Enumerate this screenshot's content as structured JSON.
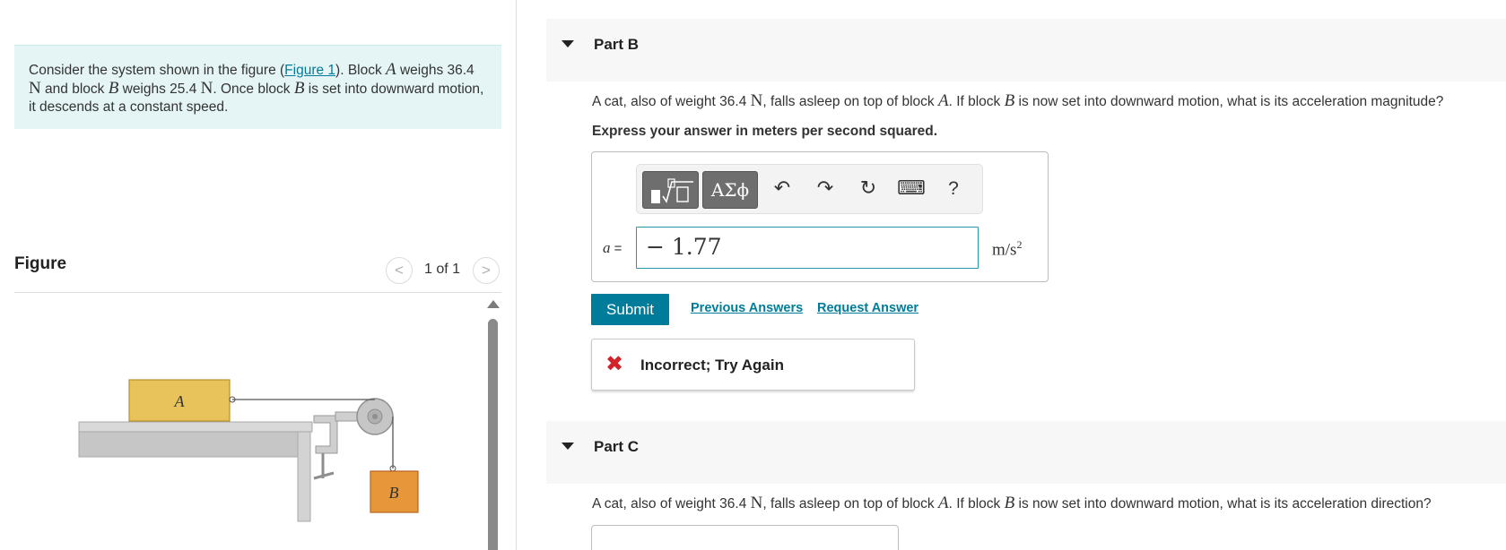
{
  "intro": {
    "text_1": "Consider the system shown in the figure (",
    "figure_link": "Figure 1",
    "text_2": "). Block ",
    "block_a": "A",
    "text_3": " weighs 36.4 ",
    "unit_n_1": "N",
    "text_4": " and block ",
    "block_b": "B",
    "text_5": " weighs 25.4 ",
    "unit_n_2": "N",
    "text_6": ". Once block ",
    "block_b_2": "B",
    "text_7": " is set into downward motion, it descends at a constant speed."
  },
  "figure": {
    "title": "Figure",
    "prev": "<",
    "count": "1 of 1",
    "next": ">",
    "label_a": "A",
    "label_b": "B",
    "colors": {
      "block_a": "#e8c35b",
      "block_b": "#e8963a",
      "table": "#c8c8c8",
      "pulley": "#b5b5b5"
    }
  },
  "partB": {
    "title": "Part B",
    "question": {
      "t1": "A cat, also of weight 36.4 ",
      "n": "N",
      "t2": ", falls asleep on top of block ",
      "a": "A",
      "t3": ". If block ",
      "b": "B",
      "t4": " is now set into downward motion, what is its acceleration magnitude?"
    },
    "instruction": "Express your answer in meters per second squared.",
    "toolbar": {
      "templates_icon": "templates-icon",
      "symbols_label": "ΑΣϕ",
      "undo": "↶",
      "redo": "↷",
      "reset": "↻",
      "keyboard": "⌨",
      "help": "?"
    },
    "variable": "a",
    "equals": " =",
    "answer_value": "− 1.77",
    "units_base": "m/s",
    "units_exp": "2",
    "submit": "Submit",
    "previous_answers": "Previous Answers",
    "request_answer": "Request Answer",
    "feedback": "Incorrect; Try Again",
    "feedback_icon": "✖"
  },
  "partC": {
    "title": "Part C",
    "question": {
      "t1": "A cat, also of weight 36.4 ",
      "n": "N",
      "t2": ", falls asleep on top of block ",
      "a": "A",
      "t3": ". If block ",
      "b": "B",
      "t4": " is now set into downward motion, what is its acceleration direction?"
    }
  },
  "colors": {
    "accent": "#007c9b",
    "intro_bg": "#e5f5f5",
    "error": "#d3222a",
    "input_border": "#2a98a8"
  }
}
